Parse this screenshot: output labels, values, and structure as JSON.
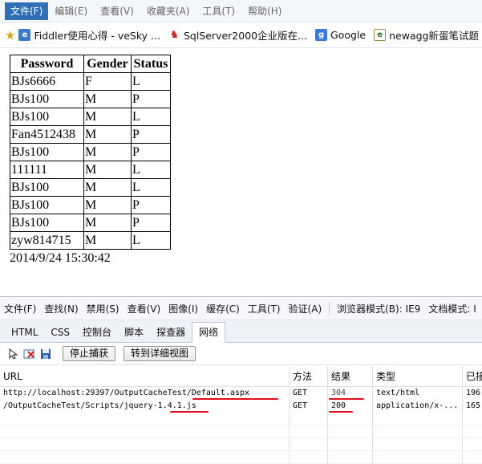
{
  "menubar": {
    "items": [
      {
        "label": "文件(F)"
      },
      {
        "label": "编辑(E)"
      },
      {
        "label": "查看(V)"
      },
      {
        "label": "收藏夹(A)"
      },
      {
        "label": "工具(T)"
      },
      {
        "label": "帮助(H)"
      }
    ]
  },
  "favorites": [
    {
      "label": "Fiddler使用心得 - veSky ...",
      "icon": "fiddler-icon"
    },
    {
      "label": "SqlServer2000企业版在...",
      "icon": "sqlserver-icon"
    },
    {
      "label": "Google",
      "icon": "google-icon"
    },
    {
      "label": "newagg新蛋笔试题（多",
      "icon": "newagg-page-icon"
    }
  ],
  "page": {
    "table": {
      "headers": [
        "Password",
        "Gender",
        "Status"
      ],
      "rows": [
        [
          "BJs6666",
          "F",
          "L"
        ],
        [
          "BJs100",
          "M",
          "P"
        ],
        [
          "BJs100",
          "M",
          "L"
        ],
        [
          "Fan4512438",
          "M",
          "P"
        ],
        [
          "BJs100",
          "M",
          "P"
        ],
        [
          "111111",
          "M",
          "L"
        ],
        [
          "BJs100",
          "M",
          "L"
        ],
        [
          "BJs100",
          "M",
          "P"
        ],
        [
          "BJs100",
          "M",
          "P"
        ],
        [
          "zyw814715",
          "M",
          "L"
        ]
      ]
    },
    "timestamp": "2014/9/24 15:30:42"
  },
  "devtools": {
    "menu": [
      "文件(F)",
      "查找(N)",
      "禁用(S)",
      "查看(V)",
      "图像(I)",
      "缓存(C)",
      "工具(T)",
      "验证(A)"
    ],
    "browser_mode": "浏览器模式(B): IE9",
    "doc_mode": "文档模式: I",
    "tabs": [
      "HTML",
      "CSS",
      "控制台",
      "脚本",
      "探查器",
      "网络"
    ],
    "active_tab": "网络",
    "toolbar": {
      "stop_capture": "停止捕获",
      "detail_view": "转到详细视图"
    },
    "network": {
      "columns": [
        "URL",
        "方法",
        "结果",
        "类型",
        "已接"
      ],
      "rows": [
        {
          "url": "http://localhost:29397/OutputCacheTest/Default.aspx",
          "method": "GET",
          "result": "304",
          "type": "text/html",
          "received": "196"
        },
        {
          "url": "/OutputCacheTest/Scripts/jquery-1.4.1.js",
          "method": "GET",
          "result": "200",
          "type": "application/x-...",
          "received": "165"
        }
      ]
    }
  }
}
